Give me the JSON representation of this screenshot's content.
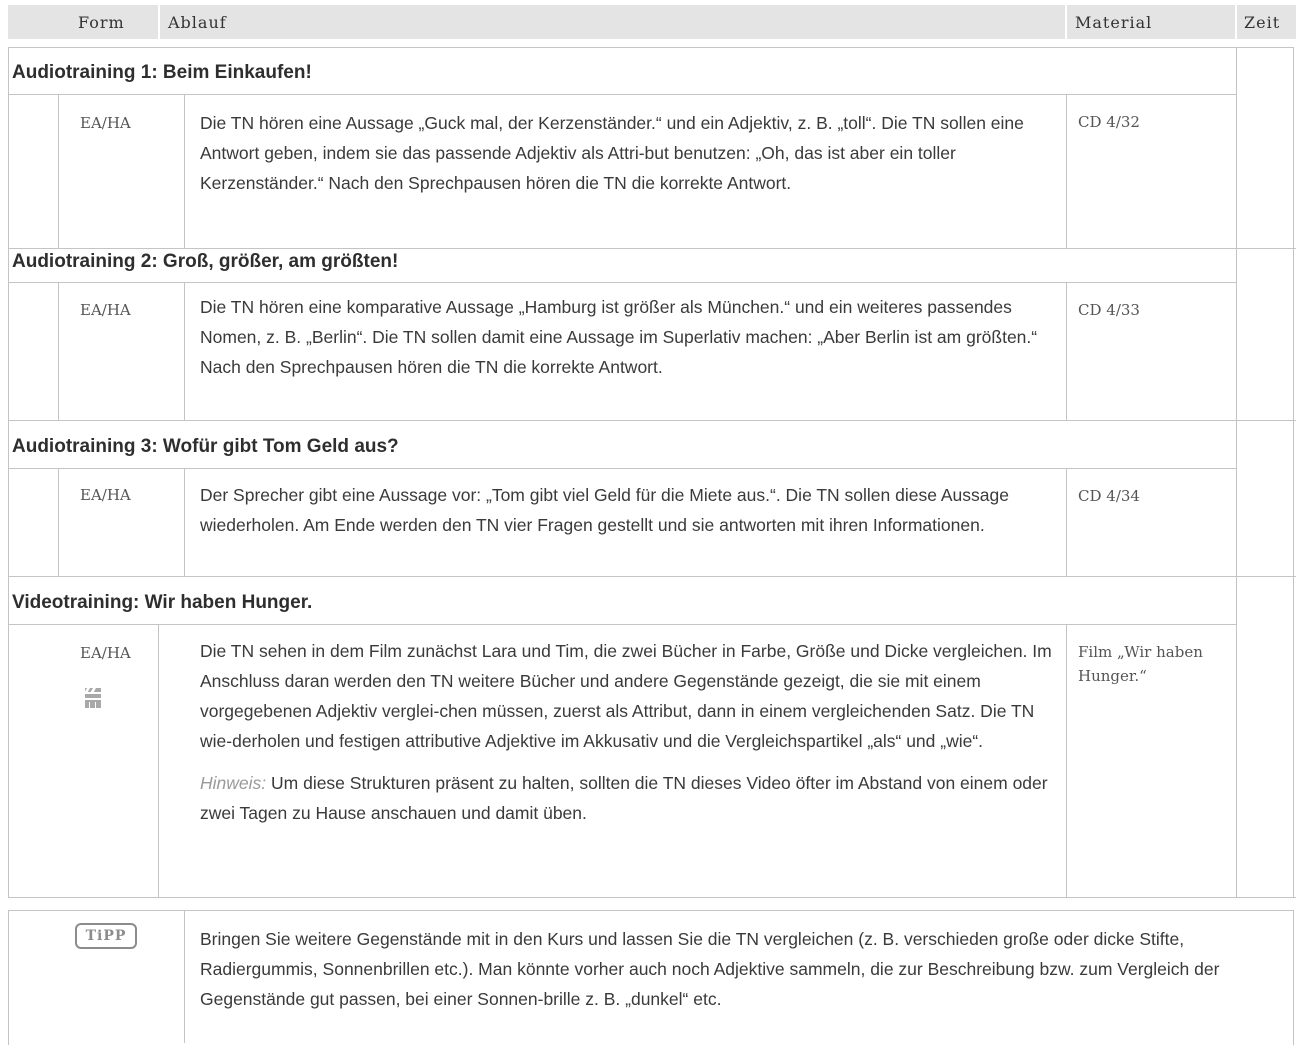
{
  "header": {
    "form": "Form",
    "ablauf": "Ablauf",
    "material": "Material",
    "zeit": "Zeit"
  },
  "sections": [
    {
      "title": "Audiotraining 1: Beim Einkaufen!",
      "form": "EA/HA",
      "text": "Die TN hören eine Aussage „Guck mal, der Kerzenständer.“ und ein Adjektiv, z. B. „toll“. Die TN sollen eine Antwort geben, indem sie das passende Adjektiv als Attri-but benutzen: „Oh, das ist aber ein toller Kerzenständer.“ Nach den Sprechpausen hören die TN die korrekte Antwort.",
      "material": "CD 4/32"
    },
    {
      "title": "Audiotraining 2: Groß, größer, am größten!",
      "form": "EA/HA",
      "text": "Die TN hören eine komparative Aussage „Hamburg ist größer als München.“ und ein weiteres passendes Nomen, z. B. „Berlin“. Die TN sollen damit eine Aussage im Superlativ machen: „Aber Berlin ist am größten.“ Nach den Sprechpausen hören die TN die korrekte Antwort.",
      "material": "CD 4/33"
    },
    {
      "title": "Audiotraining 3: Wofür gibt Tom Geld aus?",
      "form": "EA/HA",
      "text": "Der Sprecher gibt eine Aussage vor: „Tom gibt viel Geld für die Miete aus.“. Die TN sollen diese Aussage wiederholen. Am Ende werden den TN vier Fragen gestellt und sie antworten mit ihren Informationen.",
      "material": "CD 4/34"
    },
    {
      "title": "Videotraining: Wir haben Hunger.",
      "form": "EA/HA",
      "icon": "film-clapper-icon",
      "text": "Die TN sehen in dem Film zunächst Lara und Tim, die zwei Bücher in Farbe, Größe und Dicke vergleichen. Im Anschluss daran werden den TN weitere Bücher und andere Gegenstände gezeigt, die sie mit einem vorgegebenen Adjektiv verglei-chen müssen, zuerst als Attribut, dann in einem vergleichenden Satz. Die TN wie-derholen und festigen attributive Adjektive im Akkusativ und die Vergleichspartikel „als“ und „wie“.",
      "note_label": "Hinweis:",
      "note_text": " Um diese Strukturen präsent zu halten, sollten die TN dieses Video öfter im Abstand von einem oder zwei Tagen zu Hause anschauen und damit üben.",
      "material": "Film „Wir haben Hunger.“"
    }
  ],
  "tipp": {
    "badge": "TiPP",
    "text": "Bringen Sie weitere Gegenstände mit in den Kurs und lassen Sie die TN vergleichen (z. B. verschieden große oder dicke Stifte, Radiergummis, Sonnenbrillen etc.). Man könnte vorher auch noch Adjektive sammeln, die zur Beschreibung bzw. zum Vergleich der Gegenstände gut passen, bei einer Sonnen-brille z. B. „dunkel“ etc."
  },
  "colors": {
    "header_bg": "#e4e4e4",
    "rule": "#c4c4c4",
    "text": "#3a3a3a",
    "muted": "#9a9a9a"
  }
}
